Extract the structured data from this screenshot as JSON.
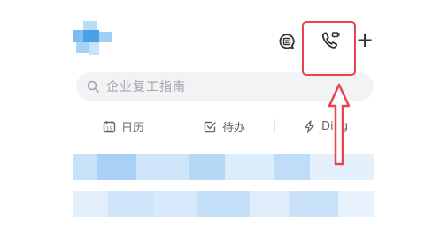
{
  "header": {
    "avatar_icon": "blurred-avatar",
    "chat_icon": "chat-bubble-icon",
    "call_icon": "phone-call-icon",
    "add_label": "+"
  },
  "search": {
    "placeholder": "企业复工指南",
    "icon": "search-icon"
  },
  "tabs": [
    {
      "label": "日历",
      "icon": "calendar-icon"
    },
    {
      "label": "待办",
      "icon": "check-square-icon"
    },
    {
      "label": "Ding",
      "icon": "lightning-icon"
    }
  ],
  "annotation": {
    "highlight_color": "#e8434e",
    "target": "phone-call-button"
  },
  "colors": {
    "accent_blue": "#4aa0ea",
    "search_bg": "#f2f3f5",
    "annotation_red": "#e8434e"
  }
}
